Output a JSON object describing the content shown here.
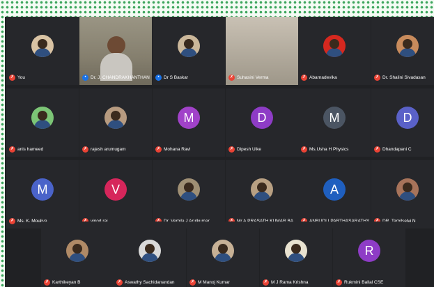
{
  "participants": [
    {
      "name": "You",
      "initial": "",
      "avatar": "photo",
      "avatar_color": "#d9c3a4",
      "muted": true
    },
    {
      "name": "Dr. J. CHANDRAKHANTHAN S...",
      "initial": "",
      "avatar": "video",
      "avatar_color": "#9a9584",
      "muted": false
    },
    {
      "name": "Dr S Baskar",
      "initial": "",
      "avatar": "photo",
      "avatar_color": "#cbb79a",
      "muted": false
    },
    {
      "name": "Suhasini Verma",
      "initial": "",
      "avatar": "video",
      "avatar_color": "#c9c1b4",
      "muted": true
    },
    {
      "name": "Abarnadevika",
      "initial": "",
      "avatar": "photo",
      "avatar_color": "#d6281f",
      "muted": true
    },
    {
      "name": "Dr. Shalini Sivadasan",
      "initial": "",
      "avatar": "photo",
      "avatar_color": "#c88b5c",
      "muted": true
    },
    {
      "name": "anis hameed",
      "initial": "",
      "avatar": "photo",
      "avatar_color": "#7cc576",
      "muted": true
    },
    {
      "name": "rajesh arumugam",
      "initial": "",
      "avatar": "photo",
      "avatar_color": "#b79b80",
      "muted": true
    },
    {
      "name": "Mohana Ravi",
      "initial": "M",
      "avatar": "letter",
      "avatar_color": "#a142c9",
      "muted": true
    },
    {
      "name": "Dipesh Uike",
      "initial": "D",
      "avatar": "letter",
      "avatar_color": "#8e3cc6",
      "muted": true
    },
    {
      "name": "Ms.Usha H Physics",
      "initial": "M",
      "avatar": "letter",
      "avatar_color": "#4b5563",
      "muted": true
    },
    {
      "name": "Dhandapani C",
      "initial": "D",
      "avatar": "letter",
      "avatar_color": "#5a61c8",
      "muted": true
    },
    {
      "name": "Ms. K. Mouliya",
      "initial": "M",
      "avatar": "letter",
      "avatar_color": "#4a63c9",
      "muted": true
    },
    {
      "name": "vinod raj",
      "initial": "V",
      "avatar": "letter",
      "avatar_color": "#d6265b",
      "muted": true
    },
    {
      "name": "Dr. Vemila J Arulkumar",
      "initial": "",
      "avatar": "photo",
      "avatar_color": "#9f8f74",
      "muted": true
    },
    {
      "name": "Mr.A.PRASATH KUMAR BA",
      "initial": "",
      "avatar": "photo",
      "avatar_color": "#b8a083",
      "muted": true
    },
    {
      "name": "ANBUOLI PARTHASARATHY",
      "initial": "A",
      "avatar": "letter",
      "avatar_color": "#1f5fbf",
      "muted": true
    },
    {
      "name": "DR. Tamilselvi N",
      "initial": "",
      "avatar": "photo",
      "avatar_color": "#a7735a",
      "muted": true
    },
    {
      "name": "Karthikeyan B",
      "initial": "",
      "avatar": "photo",
      "avatar_color": "#b08a66",
      "muted": true
    },
    {
      "name": "Aswathy Sachidanandan",
      "initial": "",
      "avatar": "photo",
      "avatar_color": "#d9d9d9",
      "muted": true
    },
    {
      "name": "M Manoj Kumar",
      "initial": "",
      "avatar": "photo",
      "avatar_color": "#c7b196",
      "muted": true
    },
    {
      "name": "M J Rama Krishna",
      "initial": "",
      "avatar": "photo",
      "avatar_color": "#e8e2d0",
      "muted": true
    },
    {
      "name": "Rukmini Ballal CSE",
      "initial": "R",
      "avatar": "letter",
      "avatar_color": "#8e3cc6",
      "muted": true
    }
  ],
  "icons": {
    "mic_muted": "mic-off-icon",
    "mic_on": "mic-on-icon"
  },
  "colors": {
    "background": "#202124",
    "tile": "#26272b",
    "frame_dots": "#3ca55c",
    "mute_badge": "#ea4335"
  }
}
